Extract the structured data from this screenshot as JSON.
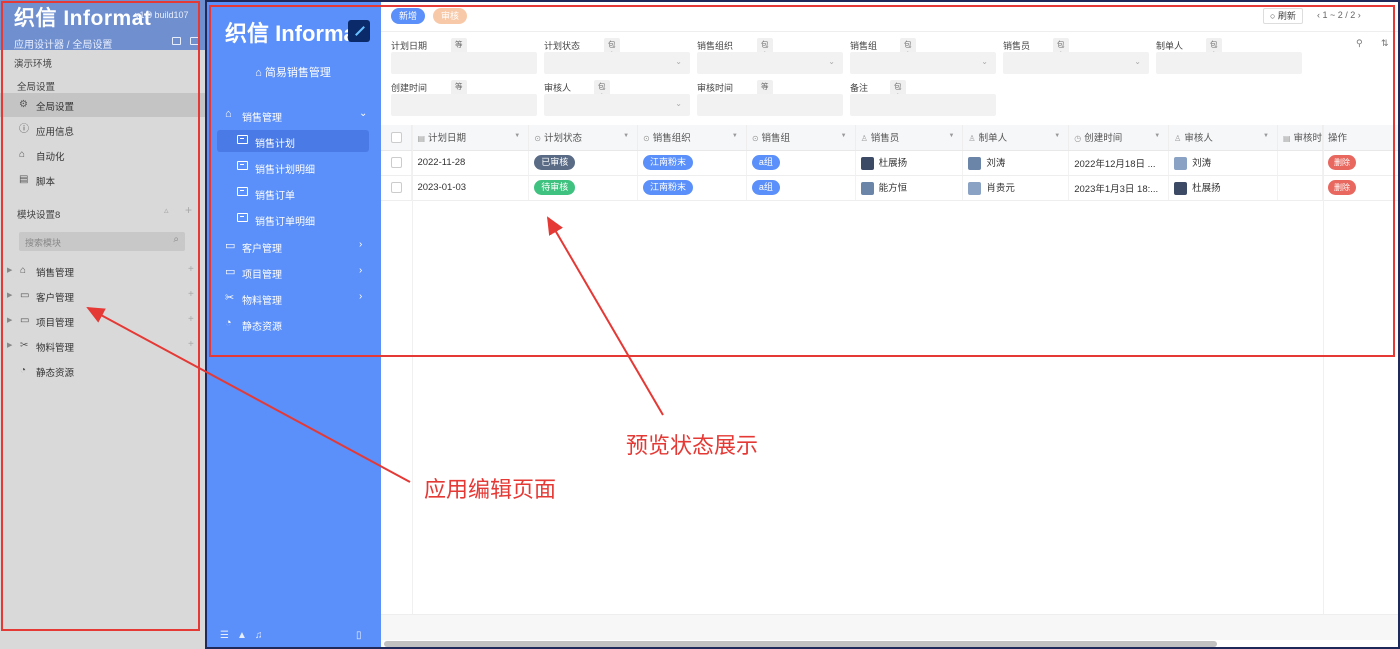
{
  "editor": {
    "logo": "织信 Informat",
    "version": "v1.0 build107",
    "breadcrumb": "应用设计器 / 全局设置",
    "env_label": "演示环境",
    "global_section": "全局设置",
    "global_items": [
      {
        "label": "全局设置",
        "icon": "gear-icon",
        "glyph": "⚙"
      },
      {
        "label": "应用信息",
        "icon": "info-icon",
        "glyph": "ⓘ"
      },
      {
        "label": "自动化",
        "icon": "robot-icon",
        "glyph": "⌂"
      },
      {
        "label": "脚本",
        "icon": "script-icon",
        "glyph": "▤"
      }
    ],
    "module_section": "模块设置8",
    "search_placeholder": "搜索模块",
    "modules": [
      {
        "label": "销售管理",
        "icon": "home-icon",
        "glyph": "⌂"
      },
      {
        "label": "客户管理",
        "icon": "window-icon",
        "glyph": "▭"
      },
      {
        "label": "项目管理",
        "icon": "folder-icon",
        "glyph": "▭"
      },
      {
        "label": "物料管理",
        "icon": "scissors-icon",
        "glyph": "✂"
      },
      {
        "label": "静态资源",
        "icon": "resource-icon",
        "glyph": "◔"
      }
    ]
  },
  "preview": {
    "logo": "织信 Informat",
    "app_name": "⌂ 简易销售管理",
    "menu": [
      {
        "label": "销售管理",
        "icon": "home-icon",
        "glyph": "⌂",
        "arrow": "⌄"
      },
      {
        "label": "客户管理",
        "icon": "window-icon",
        "glyph": "▭",
        "arrow": "›"
      },
      {
        "label": "项目管理",
        "icon": "folder-icon",
        "glyph": "▭",
        "arrow": "›"
      },
      {
        "label": "物料管理",
        "icon": "scissors-icon",
        "glyph": "✂",
        "arrow": "›"
      },
      {
        "label": "静态资源",
        "icon": "resource-icon",
        "glyph": "◔",
        "arrow": ""
      }
    ],
    "submenu": [
      "销售计划",
      "销售计划明细",
      "销售订单",
      "销售订单明细"
    ],
    "toolbar": {
      "new_label": "新增",
      "review_label": "审核",
      "refresh_label": "○ 刷新",
      "pager": "‹  1 ~ 2 / 2  ›"
    },
    "filters": [
      {
        "label": "计划日期",
        "op": "等于",
        "dropdown": false
      },
      {
        "label": "计划状态",
        "op": "包含",
        "dropdown": true
      },
      {
        "label": "销售组织",
        "op": "包含",
        "dropdown": true
      },
      {
        "label": "销售组",
        "op": "包含",
        "dropdown": true
      },
      {
        "label": "销售员",
        "op": "包含",
        "dropdown": true
      },
      {
        "label": "制单人",
        "op": "包含",
        "dropdown": false
      },
      {
        "label": "创建时间",
        "op": "等于",
        "dropdown": false
      },
      {
        "label": "审核人",
        "op": "包含",
        "dropdown": true
      },
      {
        "label": "审核时间",
        "op": "等于",
        "dropdown": false
      },
      {
        "label": "备注",
        "op": "包含",
        "dropdown": false
      }
    ],
    "columns": [
      "计划日期",
      "计划状态",
      "销售组织",
      "销售组",
      "销售员",
      "制单人",
      "创建时间",
      "审核人",
      "审核时",
      "操作"
    ],
    "rows": [
      {
        "date": "2022-11-28",
        "status": "已审核",
        "status_color": "#5a6b86",
        "org": "江南粉末",
        "group": "a组",
        "seller": "杜展扬",
        "creator": "刘涛",
        "created": "2022年12月18日 ...",
        "reviewer": "刘涛",
        "action": "删除"
      },
      {
        "date": "2023-01-03",
        "status": "待审核",
        "status_color": "#3fc27f",
        "org": "江南粉末",
        "group": "a组",
        "seller": "能方恒",
        "creator": "肖贵元",
        "created": "2023年1月3日 18:...",
        "reviewer": "杜展扬",
        "action": "删除"
      }
    ]
  },
  "annotations": {
    "preview_note": "预览状态展示",
    "editor_note": "应用编辑页面"
  },
  "colors": {
    "primary": "#5b8ff9",
    "annotation": "#e53935",
    "approved": "#5a6b86",
    "pending": "#3fc27f",
    "delete": "#e8675f"
  }
}
